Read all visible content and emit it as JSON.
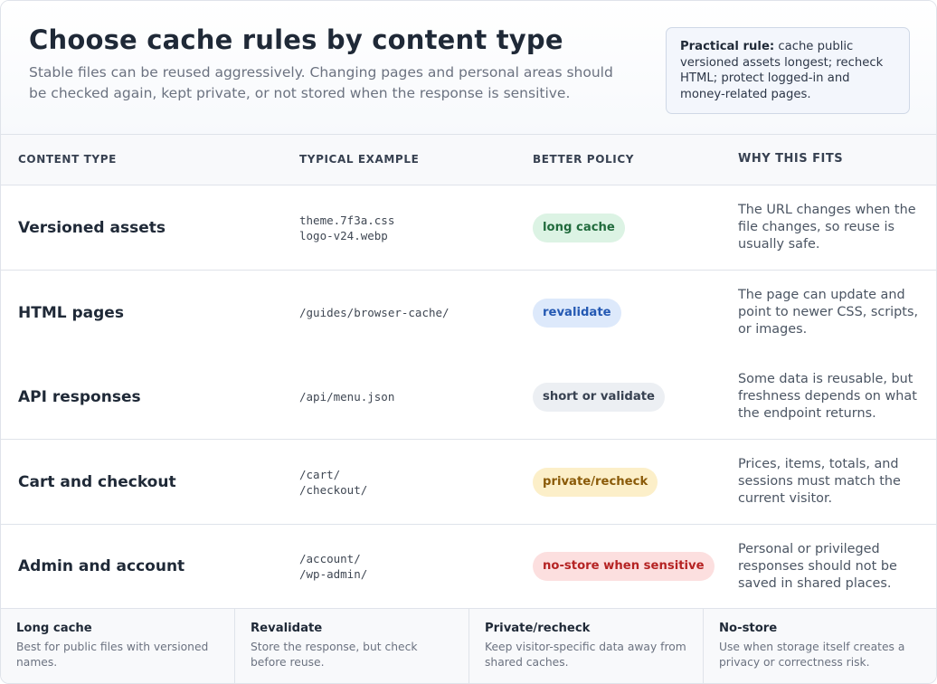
{
  "header": {
    "title": "Choose cache rules by content type",
    "subtitle": "Stable files can be reused aggressively. Changing pages and personal areas should be checked again, kept private, or not stored when the response is sensitive.",
    "rule_label": "Practical rule:",
    "rule_text": " cache public versioned assets longest; recheck HTML; protect logged-in and money-related pages."
  },
  "columns": {
    "type": "CONTENT TYPE",
    "example": "TYPICAL EXAMPLE",
    "policy": "BETTER POLICY",
    "why": "WHY THIS FITS"
  },
  "rows": [
    {
      "type": "Versioned assets",
      "examples": [
        "theme.7f3a.css",
        "logo-v24.webp"
      ],
      "policy": "long cache",
      "policy_color": "#216b3d",
      "why": "The URL changes when the file changes, so reuse is usually safe."
    },
    {
      "type": "HTML pages",
      "examples": [
        "/guides/browser-cache/",
        ""
      ],
      "policy": "revalidate",
      "policy_color": "#2459b3",
      "why": "The page can update and point to newer CSS, scripts, or images."
    },
    {
      "type": "API responses",
      "examples": [
        "/api/menu.json",
        ""
      ],
      "policy": "short or validate",
      "policy_color": "#374151",
      "why": "Some data is reusable, but freshness depends on what the endpoint returns."
    },
    {
      "type": "Cart and checkout",
      "examples": [
        "/cart/",
        "/checkout/"
      ],
      "policy": "private/recheck",
      "policy_color": "#8a5a08",
      "why": "Prices, items, totals, and sessions must match the current visitor."
    },
    {
      "type": "Admin and account",
      "examples": [
        "/account/",
        "/wp-admin/"
      ],
      "policy": "no-store when sensitive",
      "policy_color": "#b52323",
      "why": "Personal or privileged responses should not be saved in shared places."
    }
  ],
  "legend": [
    {
      "title": "Long cache",
      "desc": "Best for public files with versioned names."
    },
    {
      "title": "Revalidate",
      "desc": "Store the response, but check before reuse."
    },
    {
      "title": "Private/recheck",
      "desc": "Keep visitor-specific data away from shared caches."
    },
    {
      "title": "No-store",
      "desc": "Use when storage itself creates a privacy or correctness risk."
    }
  ]
}
